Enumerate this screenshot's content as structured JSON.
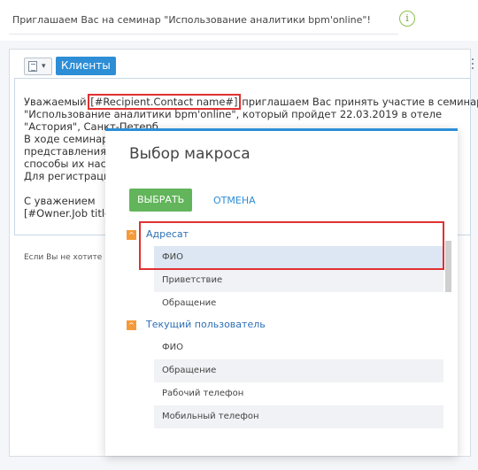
{
  "subject": {
    "text": "Приглашаем Вас на семинар \"Использование аналитики bpm'online\"!",
    "info_icon": "info-icon",
    "info_glyph": "i"
  },
  "toolbar": {
    "dropdown_icon": "template-icon",
    "caret": "▾",
    "clients_button": "Клиенты"
  },
  "email_body": {
    "line1_pre": "Уважаемый ",
    "line1_macro": "[#Recipient.Contact name#]",
    "line1_post": " приглашаем Вас принять участие в семинаре",
    "line2": "\"Использование аналитики bpm'online\", который пройдет 22.03.2019 в отеле",
    "line3": "\"Астория\", Санкт-Петерб",
    "line4": "В ходе семинара",
    "line5": "представления а",
    "line6": "способы их наст",
    "line7": "Для регистрации",
    "line8": "",
    "line9": "С уважением",
    "line10": "[#Owner.Job title"
  },
  "footer": {
    "text": "Если Вы не хотите"
  },
  "modal": {
    "title": "Выбор макроса",
    "select_button": "ВЫБРАТЬ",
    "cancel_button": "ОТМЕНА",
    "groups": [
      {
        "label": "Адресат",
        "toggle": "^",
        "items": [
          {
            "label": "ФИО"
          },
          {
            "label": "Приветствие"
          },
          {
            "label": "Обращение"
          }
        ]
      },
      {
        "label": "Текущий пользователь",
        "toggle": "^",
        "items": [
          {
            "label": "ФИО"
          },
          {
            "label": "Обращение"
          },
          {
            "label": "Рабочий телефон"
          },
          {
            "label": "Мобильный телефон"
          }
        ]
      }
    ]
  },
  "colors": {
    "accent": "#2d8ed6",
    "select_button": "#62b55a",
    "tree_toggle": "#f59a3b",
    "highlight": "#e03131"
  }
}
